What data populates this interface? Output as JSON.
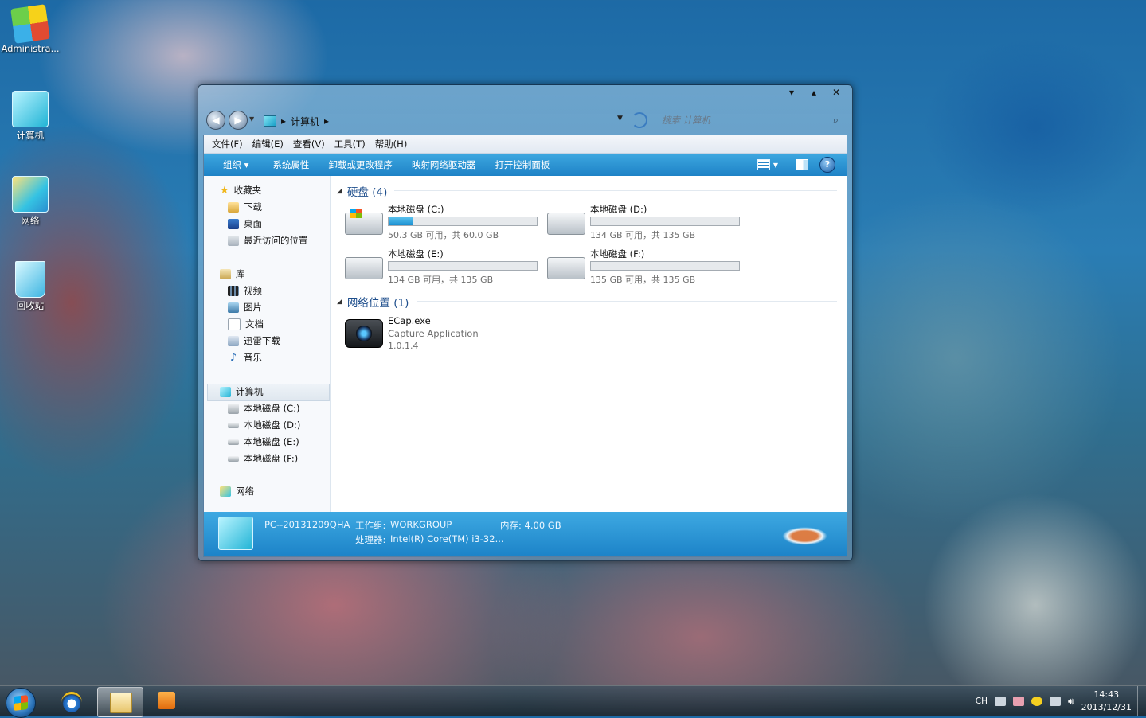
{
  "desktop": {
    "icons": [
      {
        "label": "Administra...",
        "icon": "user-folder-icon"
      },
      {
        "label": "计算机",
        "icon": "computer-icon"
      },
      {
        "label": "网络",
        "icon": "network-icon"
      },
      {
        "label": "回收站",
        "icon": "recycle-bin-icon"
      }
    ]
  },
  "window": {
    "caption_buttons": [
      "▾",
      "▴",
      "✕"
    ],
    "address": {
      "sep1": "▸",
      "location": "计算机",
      "sep2": "▸"
    },
    "search": {
      "placeholder": "搜索 计算机"
    },
    "menu": [
      "文件(F)",
      "编辑(E)",
      "查看(V)",
      "工具(T)",
      "帮助(H)"
    ],
    "toolbar": {
      "organize": "组织 ▾",
      "items": [
        "系统属性",
        "卸载或更改程序",
        "映射网络驱动器",
        "打开控制面板"
      ],
      "help": "?"
    },
    "nav": {
      "favorites": {
        "title": "收藏夹",
        "items": [
          "下载",
          "桌面",
          "最近访问的位置"
        ]
      },
      "libraries": {
        "title": "库",
        "items": [
          "视频",
          "图片",
          "文档",
          "迅雷下载",
          "音乐"
        ]
      },
      "computer": {
        "title": "计算机",
        "items": [
          "本地磁盘 (C:)",
          "本地磁盘 (D:)",
          "本地磁盘 (E:)",
          "本地磁盘 (F:)"
        ]
      },
      "network": {
        "title": "网络"
      }
    },
    "hdd_group": {
      "title": "硬盘 (4)"
    },
    "drives": [
      {
        "name": "本地磁盘 (C:)",
        "free": "50.3 GB 可用，共 60.0 GB",
        "used_fraction": 0.16
      },
      {
        "name": "本地磁盘 (D:)",
        "free": "134 GB 可用，共 135 GB",
        "used_fraction": 0.0
      },
      {
        "name": "本地磁盘 (E:)",
        "free": "134 GB 可用，共 135 GB",
        "used_fraction": 0.0
      },
      {
        "name": "本地磁盘 (F:)",
        "free": "135 GB 可用，共 135 GB",
        "used_fraction": 0.0
      }
    ],
    "net_group": {
      "title": "网络位置 (1)"
    },
    "app": {
      "name": "ECap.exe",
      "desc": "Capture Application",
      "version": "1.0.1.4"
    },
    "details": {
      "pcname": "PC--20131209QHA",
      "workgroup_label": "工作组:",
      "workgroup": "WORKGROUP",
      "memory": "内存: 4.00 GB",
      "processor_label": "处理器:",
      "processor": "Intel(R) Core(TM) i3-32..."
    }
  },
  "taskbar": {
    "apps": [
      "internet-explorer-icon",
      "explorer-icon",
      "media-player-icon"
    ],
    "lang": "CH",
    "time": "14:43",
    "date": "2013/12/31"
  }
}
